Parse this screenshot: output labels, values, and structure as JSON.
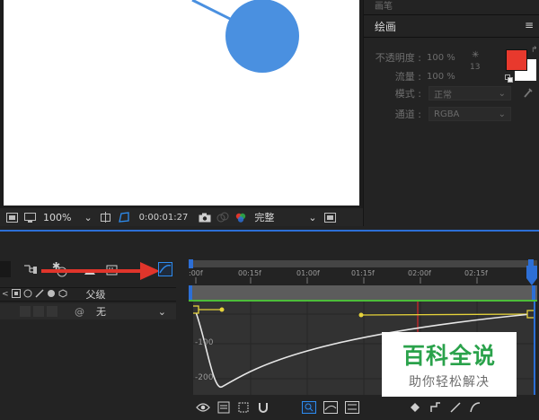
{
  "viewer": {
    "zoom": "100%",
    "timecode": "0:00:01:27",
    "resolution": "完整",
    "circle_color": "#4a90e0",
    "line_color": "#4a90e0"
  },
  "right_panel": {
    "top_title": "画笔",
    "title": "绘画",
    "menu_icon": "hamburger-icon",
    "opacity_label": "不透明度 :",
    "opacity_value": "100 %",
    "flow_label": "流量 :",
    "flow_value": "100 %",
    "mode_label": "模式 :",
    "mode_value": "正常",
    "channel_label": "通道 :",
    "channel_value": "RGBA",
    "brush_size": "13",
    "fg_color": "#e8392d",
    "bg_color": "#ffffff"
  },
  "timeline": {
    "ruler_labels": [
      ":00f",
      "00:15f",
      "01:00f",
      "01:15f",
      "02:00f",
      "02:15f"
    ],
    "parent_label": "父级",
    "parent_value": "无",
    "graph_axis_labels": [
      "-100",
      "-200"
    ],
    "accent_color": "#2d6fd6",
    "arrow_color": "#e0352b"
  },
  "watermark": {
    "title": "百科全说",
    "subtitle": "助你轻松解决"
  }
}
